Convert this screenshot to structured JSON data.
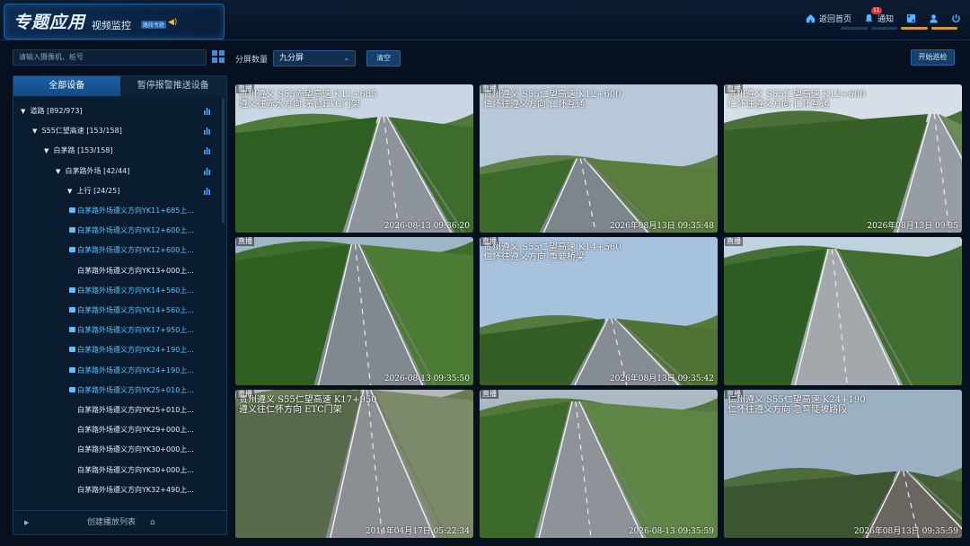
{
  "header": {
    "title": "专题应用",
    "module": "视频监控",
    "module_tag": "路段专题",
    "nav": [
      {
        "label": "返回首页",
        "icon": "home-icon"
      },
      {
        "label": "通知",
        "icon": "bell-icon",
        "badge": "11"
      }
    ]
  },
  "sidebar": {
    "search_placeholder": "请输入摄像机、桩号",
    "tabs": [
      "全部设备",
      "暂停报警推送设备"
    ],
    "tree": [
      {
        "label": "道路 [892/973]",
        "level": 0,
        "type": "group"
      },
      {
        "label": "S55仁望高速 [153/158]",
        "level": 1,
        "type": "group"
      },
      {
        "label": "白茅路 [153/158]",
        "level": 2,
        "type": "group"
      },
      {
        "label": "白茅路外场 [42/44]",
        "level": 3,
        "type": "group"
      },
      {
        "label": "上行 [24/25]",
        "level": 4,
        "type": "group"
      },
      {
        "label": "白茅路外场遵义方向YK11+685上...",
        "level": 5,
        "type": "cam",
        "online": true
      },
      {
        "label": "白茅路外场遵义方向YK12+600上...",
        "level": 5,
        "type": "cam",
        "online": true
      },
      {
        "label": "白茅路外场遵义方向YK12+600上...",
        "level": 5,
        "type": "cam",
        "online": true
      },
      {
        "label": "白茅路外场遵义方向YK13+000上...",
        "level": 5,
        "type": "cam",
        "online": false
      },
      {
        "label": "白茅路外场遵义方向YK14+560上...",
        "level": 5,
        "type": "cam",
        "online": true
      },
      {
        "label": "白茅路外场遵义方向YK14+560上...",
        "level": 5,
        "type": "cam",
        "online": true
      },
      {
        "label": "白茅路外场遵义方向YK17+950上...",
        "level": 5,
        "type": "cam",
        "online": true
      },
      {
        "label": "白茅路外场遵义方向YK24+190上...",
        "level": 5,
        "type": "cam",
        "online": true
      },
      {
        "label": "白茅路外场遵义方向YK24+190上...",
        "level": 5,
        "type": "cam",
        "online": true
      },
      {
        "label": "白茅路外场遵义方向YK25+010上...",
        "level": 5,
        "type": "cam",
        "online": true
      },
      {
        "label": "白茅路外场遵义方向YK25+010上...",
        "level": 5,
        "type": "cam",
        "online": false
      },
      {
        "label": "白茅路外场遵义方向YK29+000上...",
        "level": 5,
        "type": "cam",
        "online": false
      },
      {
        "label": "白茅路外场遵义方向YK30+000上...",
        "level": 5,
        "type": "cam",
        "online": false
      },
      {
        "label": "白茅路外场遵义方向YK30+000上...",
        "level": 5,
        "type": "cam",
        "online": false
      },
      {
        "label": "白茅路外场遵义方向YK32+490上...",
        "level": 5,
        "type": "cam",
        "online": false
      }
    ],
    "footer_label": "创建播放列表"
  },
  "toolbar": {
    "split_label": "分屏数量",
    "split_value": "九分屏",
    "clear_label": "清空",
    "patrol_label": "开始巡检"
  },
  "colors": {
    "accent": "#1b5fa6",
    "online": "#5ec1ff",
    "badge": "#e0323a"
  },
  "videos": [
    {
      "live": "直播",
      "osd": "贵州遵义 S55赤望高速 K11+685\n遵义往赤水方向 茅台ETC门架",
      "time": "2026-08-13   09:36:20"
    },
    {
      "live": "直播",
      "osd": "贵州遵义 S55仁望高速 K12+600\n仁怀往遵义方向 仁怀互通",
      "time": "2026年08月13日 09:35:48"
    },
    {
      "live": "直播",
      "osd": "贵州遵义 S55仁望高速 K12+600\n仁怀往遵义方向 仁怀互通",
      "time": "2026年08月13日 09:35"
    },
    {
      "live": "直播",
      "osd": "",
      "time": "2026-08-13 09:35:50"
    },
    {
      "live": "直播",
      "osd": "贵州遵义 S55仁望高速 K14+560\n仁怀往遵义方向 重要桥梁",
      "time": "2026年08月13日 09:35:42"
    },
    {
      "live": "直播",
      "osd": "",
      "time": ""
    },
    {
      "live": "直播",
      "osd": "贵州遵义 S55仁望高速 K17+950\n遵义往仁怀方向 ETC门架",
      "time": "2014年04月17日 05:22:34"
    },
    {
      "live": "直播",
      "osd": "",
      "time": "2026-08-13 09:35:59"
    },
    {
      "live": "直播",
      "osd": "仁州遵义 S55仁望高速 K24+190\n仁怀往遵义方向 急弯陡坡路段",
      "time": "2026年08月13日 09:35:59"
    }
  ]
}
